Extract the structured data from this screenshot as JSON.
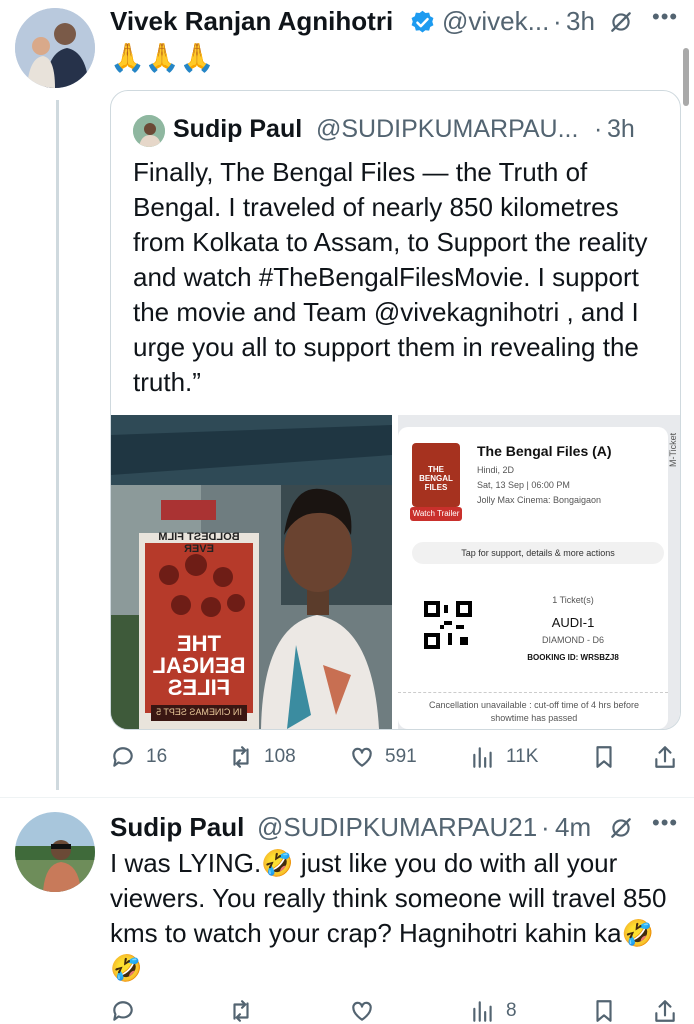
{
  "main_tweet": {
    "author_name": "Vivek Ranjan Agnihotri",
    "handle": "@vivek...",
    "separator": "·",
    "time": "3h",
    "text": "🙏🙏🙏",
    "actions": {
      "replies": "16",
      "retweets": "108",
      "likes": "591",
      "views": "11K"
    }
  },
  "quoted_tweet": {
    "author_name": "Sudip Paul",
    "handle": "@SUDIPKUMARPAU...",
    "separator": "·",
    "time": "3h",
    "text": "Finally, The Bengal Files — the Truth of Bengal. I traveled  of nearly 850 kilometres from Kolkata to Assam, to Support the reality and watch #TheBengalFilesMovie. I support the movie and Team @vivekagnihotri , and I urge you all to support them in revealing the truth.”",
    "photo": {
      "poster_banner": "BOLDEST FILM EVER",
      "poster_title_1": "THE",
      "poster_title_2": "BENGAL",
      "poster_title_3": "FILES",
      "poster_footer": "IN CINEMAS SEPT 5"
    },
    "ticket": {
      "movie_title": "The Bengal Files (A)",
      "language": "Hindi, 2D",
      "datetime": "Sat, 13 Sep | 06:00 PM",
      "venue": "Jolly Max Cinema: Bongaigaon",
      "thumb_title": "THE BENGAL FILES",
      "watch_trailer": "Watch Trailer",
      "side_label": "M-Ticket",
      "support_bar": "Tap for support, details & more actions",
      "ticket_count": "1 Ticket(s)",
      "screen": "AUDI-1",
      "seat": "DIAMOND - D6",
      "booking_id": "BOOKING ID: WRSBZJ8",
      "cancellation": "Cancellation unavailable : cut-off time of 4 hrs before showtime has passed"
    }
  },
  "reply_tweet": {
    "author_name": "Sudip Paul",
    "handle": "@SUDIPKUMARPAU21",
    "separator": "·",
    "time": "4m",
    "text": "I was LYING.🤣 just like you do with all your viewers. You really think someone will travel 850 kms to watch your crap? Hagnihotri kahin ka🤣🤣",
    "actions": {
      "views": "8"
    }
  },
  "colors": {
    "text": "#0f1419",
    "secondary": "#536471",
    "border": "#cfd9de",
    "verified": "#1d9bf0"
  },
  "icons": [
    "verified-badge-icon",
    "grok-icon",
    "more-icon",
    "reply-icon",
    "retweet-icon",
    "like-icon",
    "views-icon",
    "bookmark-icon",
    "share-icon",
    "qr-code-icon"
  ]
}
